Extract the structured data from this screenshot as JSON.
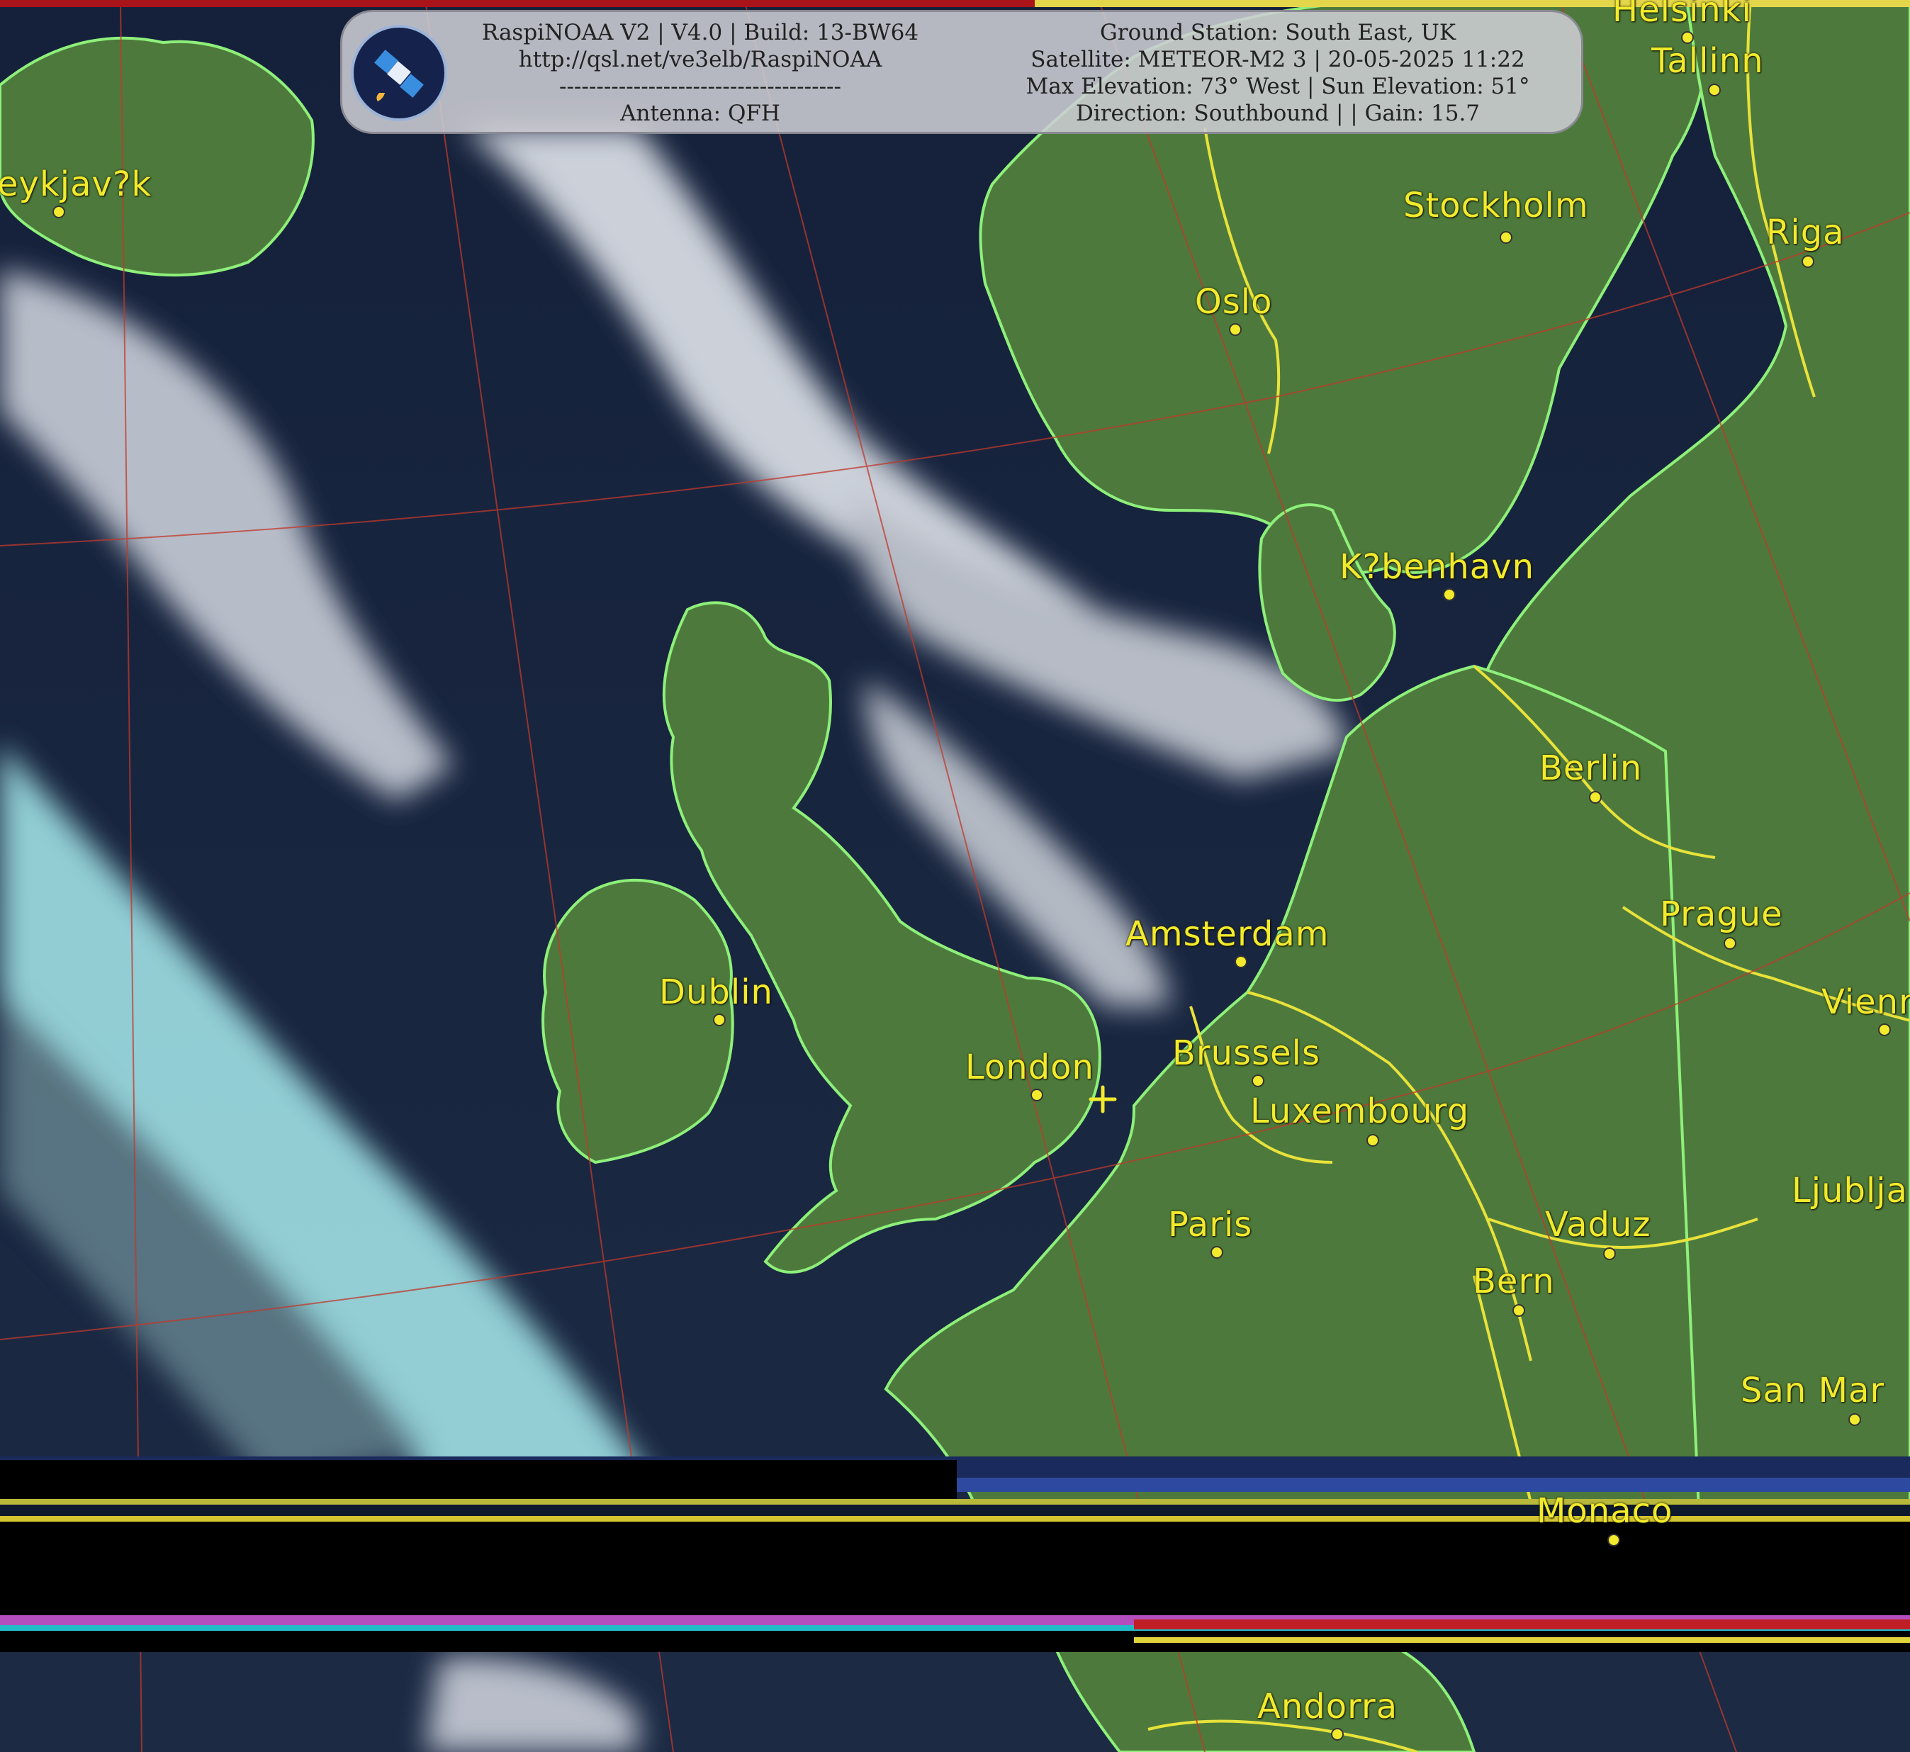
{
  "header": {
    "left_lines": [
      "RaspiNOAA V2 | V4.0 | Build: 13-BW64",
      "http://qsl.net/ve3elb/RaspiNOAA",
      "--------------------------------------",
      "Antenna: QFH"
    ],
    "right_lines": [
      "Ground Station: South East, UK",
      "Satellite: METEOR-M2 3 | 20-05-2025 11:22",
      "Max Elevation: 73° West | Sun Elevation: 51°",
      "Direction: Southbound | | Gain: 15.7"
    ]
  },
  "cities": [
    {
      "id": "helsinki",
      "label": "Helsinki"
    },
    {
      "id": "tallinn",
      "label": "Tallinn"
    },
    {
      "id": "reykjavik",
      "label": "eykjav?k"
    },
    {
      "id": "stockholm",
      "label": "Stockholm"
    },
    {
      "id": "riga",
      "label": "Riga"
    },
    {
      "id": "oslo",
      "label": "Oslo"
    },
    {
      "id": "kobenhavn",
      "label": "K?benhavn"
    },
    {
      "id": "berlin",
      "label": "Berlin"
    },
    {
      "id": "prague",
      "label": "Prague"
    },
    {
      "id": "amsterdam",
      "label": "Amsterdam"
    },
    {
      "id": "dublin",
      "label": "Dublin"
    },
    {
      "id": "vienna",
      "label": "Vienn"
    },
    {
      "id": "brussels",
      "label": "Brussels"
    },
    {
      "id": "london",
      "label": "London"
    },
    {
      "id": "luxembourg",
      "label": "Luxembourg"
    },
    {
      "id": "ljubljana",
      "label": "Ljublja"
    },
    {
      "id": "paris",
      "label": "Paris"
    },
    {
      "id": "vaduz",
      "label": "Vaduz"
    },
    {
      "id": "bern",
      "label": "Bern"
    },
    {
      "id": "sanmarino",
      "label": "San Mar"
    },
    {
      "id": "monaco",
      "label": "Monaco"
    },
    {
      "id": "andorra",
      "label": "Andorra"
    }
  ],
  "colors": {
    "city_label": "#f2ea2c",
    "coastline": "#8ef07a",
    "border": "#e8e23a",
    "graticule": "#c0392b",
    "sea": "#14203a",
    "land": "#4d7a3c",
    "cloud": "#d8dde6"
  }
}
